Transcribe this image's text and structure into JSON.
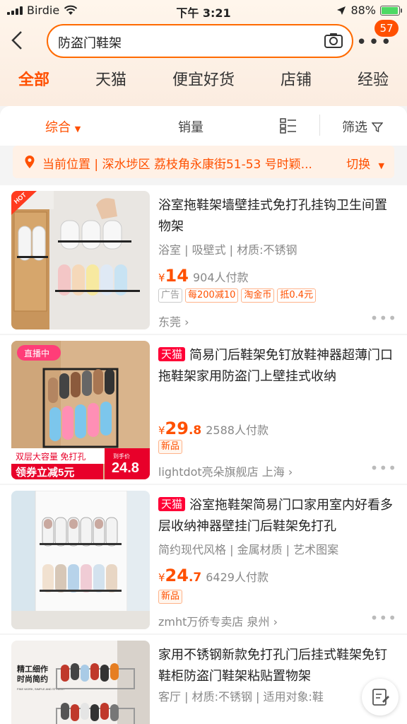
{
  "status_bar": {
    "carrier": "Birdie",
    "time": "下午 3:21",
    "battery": "88%"
  },
  "search": {
    "query": "防盗门鞋架",
    "badge_count": "57"
  },
  "tabs": [
    "全部",
    "天猫",
    "便宜好货",
    "店铺",
    "经验"
  ],
  "sort": {
    "comprehensive": "综合",
    "sales": "销量",
    "filter": "筛选"
  },
  "location": {
    "text": "当前位置 | 深水埗区 荔枝角永康街51-53 号时颖...",
    "switch": "切换"
  },
  "items": [
    {
      "title": "浴室拖鞋架墙壁挂式免打孔挂钩卫生间置物架",
      "attrs": "浴室 | 吸壁式 | 材质:不锈钢",
      "price_int": "14",
      "price_dec": "",
      "sold": "904人付款",
      "tags": [
        "广告",
        "每200减10",
        "淘金币",
        "抵0.4元"
      ],
      "shop": "东莞 ›",
      "thumb_badge": "HOT"
    },
    {
      "tmall": "天猫",
      "title": "简易门后鞋架免钉放鞋神器超薄门口拖鞋架家用防盗门上壁挂式收纳",
      "price_int": "29",
      "price_dec": ".8",
      "sold": "2588人付款",
      "tags": [
        "新品"
      ],
      "shop": "lightdot亮朵旗舰店 上海 ›",
      "thumb_live": "直播中",
      "thumb_banner1": "双层大容量 免打孔",
      "thumb_banner2": "领券立减5元",
      "thumb_price": "24.8",
      "thumb_price_label": "到手价"
    },
    {
      "tmall": "天猫",
      "title": "浴室拖鞋架简易门口家用室内好看多层收纳神器壁挂门后鞋架免打孔",
      "attrs": "简约现代风格 | 金属材质 | 艺术图案",
      "price_int": "24",
      "price_dec": ".7",
      "sold": "6429人付款",
      "tags": [
        "新品"
      ],
      "shop": "zmht万侨专卖店 泉州 ›"
    },
    {
      "title": "家用不锈钢新款免打孔门后挂式鞋架免钉鞋柜防盗门鞋架粘贴置物架",
      "attrs": "客厅 | 材质:不锈钢 | 适用对象:鞋",
      "thumb_text1": "精工细作",
      "thumb_text2": "时尚简约",
      "thumb_text3": "FINE WORK, SIMPLE AND STYLISH"
    }
  ],
  "price_symbol": "¥",
  "colors": {
    "accent": "#ff5000",
    "tmall": "#ff0036"
  }
}
